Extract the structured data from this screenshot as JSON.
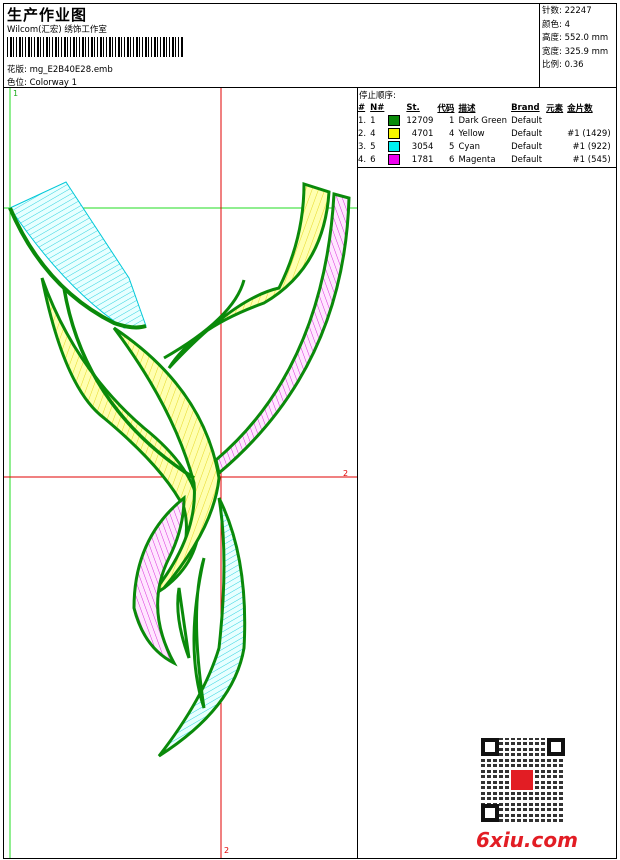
{
  "header": {
    "title": "生产作业图",
    "company": "Wilcom(汇宏) 绣饰工作室",
    "design_label": "花版:",
    "design_file": "mg_E2B40E28.emb",
    "colorway_label": "色位:",
    "colorway": "Colorway 1"
  },
  "stats": [
    {
      "label": "针数:",
      "value": "22247"
    },
    {
      "label": "颜色:",
      "value": "4"
    },
    {
      "label": "高度:",
      "value": "552.0 mm"
    },
    {
      "label": "宽度:",
      "value": "325.9 mm"
    },
    {
      "label": "比例:",
      "value": "0.36"
    }
  ],
  "stop_sequence": {
    "title": "停止顺序:",
    "columns": [
      "#",
      "N#",
      "St.",
      "代码",
      "描述",
      "Brand",
      "元素",
      "金片数"
    ],
    "rows": [
      {
        "idx": "1.",
        "n": "1",
        "color": "#0a8a0a",
        "st": "12709",
        "code": "1",
        "desc": "Dark Green",
        "brand": "Default",
        "elem": "",
        "seq": ""
      },
      {
        "idx": "2.",
        "n": "4",
        "color": "#f6f600",
        "st": "4701",
        "code": "4",
        "desc": "Yellow",
        "brand": "Default",
        "elem": "",
        "seq": "#1 (1429)"
      },
      {
        "idx": "3.",
        "n": "5",
        "color": "#00f0f0",
        "st": "3054",
        "code": "5",
        "desc": "Cyan",
        "brand": "Default",
        "elem": "",
        "seq": "#1 (922)"
      },
      {
        "idx": "4.",
        "n": "6",
        "color": "#ee00ee",
        "st": "1781",
        "code": "6",
        "desc": "Magenta",
        "brand": "Default",
        "elem": "",
        "seq": "#1 (545)"
      }
    ]
  },
  "markers": {
    "top_left": "1",
    "right": "2",
    "bottom": "2"
  },
  "watermark": "6xiu.com",
  "colors": {
    "dark_green": "#0a8a0a",
    "yellow": "#f6f600",
    "cyan": "#00f0f0",
    "magenta": "#ee00ee",
    "guide_red": "#e00000",
    "guide_green": "#22dd22"
  }
}
